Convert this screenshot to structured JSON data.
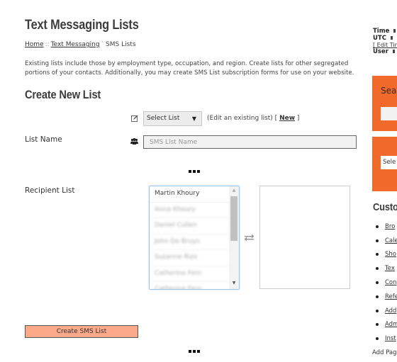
{
  "page": {
    "title": "Text Messaging Lists",
    "breadcrumb": [
      {
        "label": "Home",
        "link": true
      },
      {
        "label": "Text Messaging",
        "link": true
      },
      {
        "label": "SMS Lists",
        "link": false
      }
    ],
    "breadcrumb_separators": [
      "::",
      "`"
    ],
    "intro": "Existing lists include those by employment type, occupation, and region. Create lists for other segregated portions of your contacts. Additionally, you may create SMS List subscription forms for use on your website."
  },
  "create_form": {
    "section_title": "Create New List",
    "select_list": {
      "value": "Select List",
      "arrow": "▼"
    },
    "edit_hint_prefix": "(Edit an existing list) [",
    "new_link": "New",
    "edit_hint_suffix": "]",
    "list_name_label": "List Name",
    "list_name_placeholder": "SMS List Name",
    "list_name_value": "",
    "recipient_label": "Recipient List",
    "recipients": [
      {
        "name": "Martin Khoury",
        "obscured": false
      },
      {
        "name": "Anna Khoury",
        "obscured": true
      },
      {
        "name": "Daniel Cullen",
        "obscured": true
      },
      {
        "name": "John De Bruyn",
        "obscured": true
      },
      {
        "name": "Suzanne Rizo",
        "obscured": true
      },
      {
        "name": "Catherine Fern",
        "obscured": true
      },
      {
        "name": "Catherine Fern",
        "obscured": true
      }
    ],
    "selected_recipients": [],
    "create_button": "Create SMS List"
  },
  "sidebar": {
    "info_labels": [
      "Time",
      "UTC",
      "[ Edit Tim",
      "User"
    ],
    "search_title": "Sear",
    "select_value": "Sele",
    "custom_title": "Custo",
    "custom_links": [
      "Bro",
      "Cale",
      "Sho",
      "Tex",
      "Con",
      "Refe",
      "Add",
      "Adm",
      "Inst"
    ],
    "add_page": "Add Pag"
  },
  "colors": {
    "accent_orange": "#f26a2b",
    "button_salmon": "#fca989"
  }
}
